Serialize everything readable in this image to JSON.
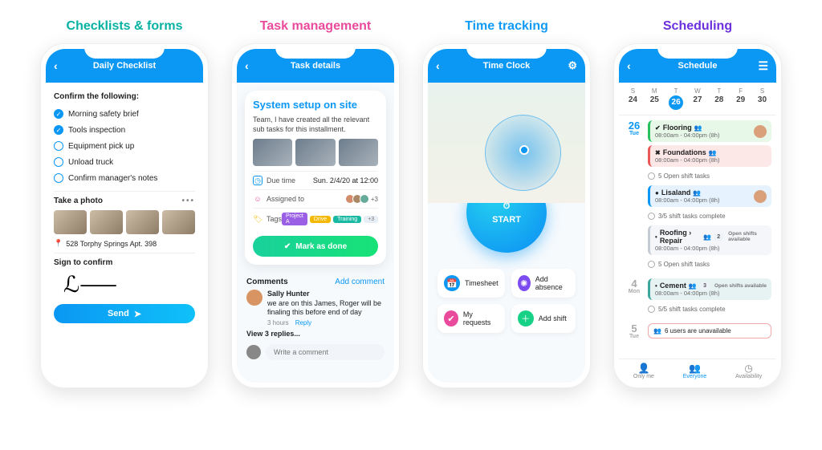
{
  "headings": {
    "h1": "Checklists & forms",
    "h2": "Task management",
    "h3": "Time tracking",
    "h4": "Scheduling"
  },
  "checklist": {
    "title": "Daily Checklist",
    "confirm": "Confirm the following:",
    "items": [
      {
        "label": "Morning safety brief",
        "done": true
      },
      {
        "label": "Tools inspection",
        "done": true
      },
      {
        "label": "Equipment pick up",
        "done": false
      },
      {
        "label": "Unload truck",
        "done": false
      },
      {
        "label": "Confirm manager's notes",
        "done": false
      }
    ],
    "photo_label": "Take a photo",
    "address_label": "528 Torphy Springs Apt. 398",
    "sign_label": "Sign to confirm",
    "send": "Send"
  },
  "task": {
    "title": "Task details",
    "name": "System setup on site",
    "desc": "Team, I have created all the relevant sub tasks for this installment.",
    "due_label": "Due time",
    "due_value": "Sun. 2/4/20 at 12:00",
    "assigned_label": "Assigned to",
    "assigned_extra": "+3",
    "tags_label": "Tags",
    "tags": [
      "Project A",
      "Drive",
      "Training"
    ],
    "tags_extra": "+3",
    "done": "Mark as done",
    "comments_label": "Comments",
    "add_comment": "Add comment",
    "commenter": "Sally Hunter",
    "comment": "we are on this James, Roger will be finaling this before end of day",
    "ago": "3 hours",
    "reply": "Reply",
    "view_replies": "View 3 replies...",
    "write_placeholder": "Write a comment"
  },
  "clock": {
    "title": "Time Clock",
    "start": "START",
    "tiles": [
      {
        "icon": "calendar",
        "label": "Timesheet"
      },
      {
        "icon": "sun",
        "label": "Add absence"
      },
      {
        "icon": "check",
        "label": "My requests"
      },
      {
        "icon": "plus",
        "label": "Add shift"
      }
    ]
  },
  "sched": {
    "title": "Schedule",
    "week": [
      {
        "d": "S",
        "n": "24"
      },
      {
        "d": "M",
        "n": "25"
      },
      {
        "d": "T",
        "n": "26",
        "sel": true
      },
      {
        "d": "W",
        "n": "27"
      },
      {
        "d": "T",
        "n": "28"
      },
      {
        "d": "F",
        "n": "29"
      },
      {
        "d": "S",
        "n": "30"
      }
    ],
    "days": [
      {
        "num": "26",
        "dw": "Tue",
        "blue": true,
        "shifts": [
          {
            "name": "Flooring",
            "time": "08:00am - 04:00pm (8h)",
            "color": "green",
            "icon": "check",
            "avatar": true
          },
          {
            "name": "Foundations",
            "time": "08:00am - 04:00pm (8h)",
            "color": "red",
            "icon": "x",
            "sub": "5 Open shift tasks"
          },
          {
            "name": "Lisaland",
            "time": "08:00am - 04:00pm (8h)",
            "color": "blue",
            "icon": "dot",
            "avatar": true,
            "sub": "3/5 shift tasks complete"
          },
          {
            "name": "Roofing › Repair",
            "time": "08:00am - 04:00pm (8h)",
            "color": "grey",
            "badge_n": "2",
            "badge_t": "Open shifts available",
            "sub": "5 Open shift tasks"
          }
        ]
      },
      {
        "num": "4",
        "dw": "Mon",
        "shifts": [
          {
            "name": "Cement",
            "time": "08:00am - 04:00pm (8h)",
            "color": "teal",
            "badge_n": "3",
            "badge_t": "Open shifts available",
            "sub": "5/5 shift tasks complete"
          }
        ]
      },
      {
        "num": "5",
        "dw": "Tue",
        "unavail": "6 users are unavailable"
      }
    ],
    "nav": [
      {
        "label": "Only me",
        "icon": "person"
      },
      {
        "label": "Everyone",
        "icon": "people",
        "active": true
      },
      {
        "label": "Availability",
        "icon": "clock"
      }
    ]
  }
}
